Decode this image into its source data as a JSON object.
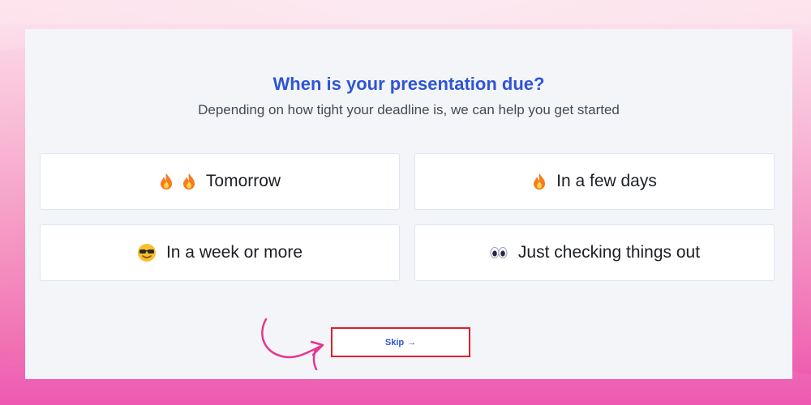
{
  "question": {
    "title": "When is your presentation due?",
    "subtitle": "Depending on how tight your deadline is, we can help you get started"
  },
  "options": [
    {
      "label": "Tomorrow",
      "icon": "fire-icon x2"
    },
    {
      "label": "In a few days",
      "icon": "fire-icon"
    },
    {
      "label": "In a week or more",
      "icon": "sunglasses-face-icon"
    },
    {
      "label": "Just checking things out",
      "icon": "eyes-icon"
    }
  ],
  "skip": {
    "label": "Skip",
    "arrow": "→"
  },
  "colors": {
    "accent": "#2f55d4",
    "highlight_border": "#e01e2b",
    "annotation_arrow": "#e8358f",
    "panel_bg": "#f3f5f9"
  }
}
